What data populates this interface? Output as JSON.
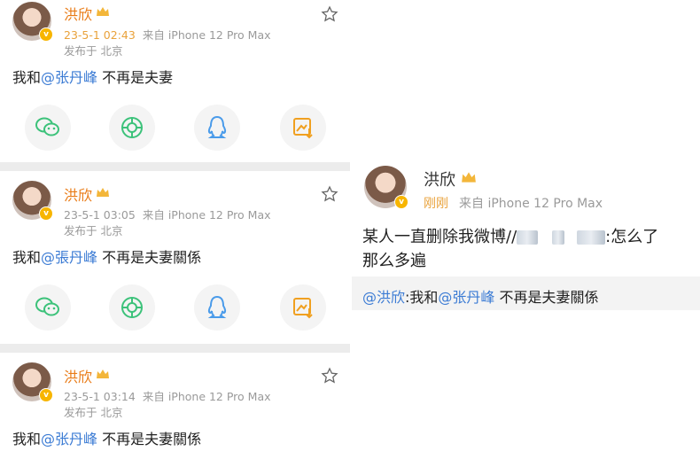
{
  "posts": [
    {
      "name": "洪欣",
      "time": "23-5-1 02:43",
      "from": "来自 iPhone 12 Pro Max",
      "loc": "发布于 北京",
      "text_prefix": "我和",
      "mention": "@张丹峰",
      "text_suffix": " 不再是夫妻"
    },
    {
      "name": "洪欣",
      "time": "23-5-1 03:05",
      "from": "来自 iPhone 12 Pro Max",
      "loc": "发布于 北京",
      "text_prefix": "我和",
      "mention": "@張丹峰",
      "text_suffix": " 不再是夫妻關係"
    },
    {
      "name": "洪欣",
      "time": "23-5-1 03:14",
      "from": "来自 iPhone 12 Pro Max",
      "loc": "发布于 北京",
      "text_prefix": "我和",
      "mention": "@张丹峰",
      "text_suffix": " 不再是夫妻關係"
    }
  ],
  "share_icons": [
    "wechat-icon",
    "moments-icon",
    "qq-icon",
    "save-image-icon"
  ],
  "right": {
    "name": "洪欣",
    "time": "刚刚",
    "from": "来自 iPhone 12 Pro Max",
    "text_line1": "某人一直删除我微博//",
    "text_after_blur": ":怎么了",
    "text_line2": "那么多遍",
    "repost_mention": "@洪欣",
    "repost_prefix": ":我和",
    "repost_mention2": "@张丹峰",
    "repost_suffix": " 不再是夫妻關係"
  },
  "colors": {
    "accent": "#e97b16",
    "link": "#3b7bd4",
    "icon_green": "#3cc27a",
    "icon_blue": "#4a9bea",
    "icon_orange": "#f0a020"
  }
}
